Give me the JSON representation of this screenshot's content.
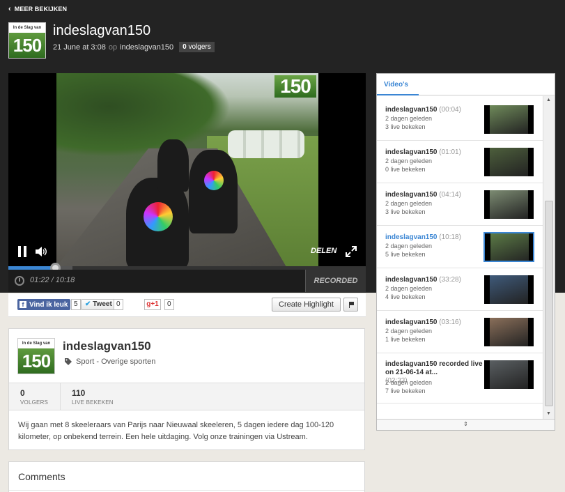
{
  "nav": {
    "back_label": "MEER BEKIJKEN"
  },
  "header": {
    "logo_text_top": "In de Slag van",
    "logo_text_number": "150",
    "title": "indeslagvan150",
    "date": "21 June at 3:08",
    "op_label": "op",
    "channel": "indeslagvan150",
    "followers_count": "0",
    "followers_label": "volgers"
  },
  "player": {
    "watermark": "150",
    "share_label": "DELEN",
    "time": "01:22 / 10:18",
    "progress_fraction": 0.13,
    "buffered_fraction": 0.18,
    "recorded_label": "RECORDED LIVE"
  },
  "social": {
    "facebook_label": "Vind ik leuk",
    "facebook_count": "5",
    "tweet_label": "Tweet",
    "tweet_count": "0",
    "gplus_label": "g+1",
    "gplus_count": "0",
    "highlight_label": "Create Highlight"
  },
  "channel_info": {
    "name": "indeslagvan150",
    "category": "Sport - Overige sporten",
    "followers_value": "0",
    "followers_label": "VOLGERS",
    "views_value": "110",
    "views_label": "LIVE BEKEKEN",
    "description": "Wij gaan met 8 skeeleraars van Parijs naar Nieuwaal skeeleren, 5 dagen iedere dag 100-120 kilometer, op onbekend terrein. Een hele uitdaging. Volg onze trainingen via Ustream."
  },
  "comments": {
    "title": "Comments"
  },
  "sidebar": {
    "tab_label": "Video's",
    "items": [
      {
        "title": "indeslagvan150",
        "duration": "(00:04)",
        "age": "2 dagen geleden",
        "views": "3 live bekeken",
        "active": false,
        "thumb_color": "#6f8a5a"
      },
      {
        "title": "indeslagvan150",
        "duration": "(01:01)",
        "age": "2 dagen geleden",
        "views": "0 live bekeken",
        "active": false,
        "thumb_color": "#4d5f3c"
      },
      {
        "title": "indeslagvan150",
        "duration": "(04:14)",
        "age": "2 dagen geleden",
        "views": "3 live bekeken",
        "active": false,
        "thumb_color": "#7c8b72"
      },
      {
        "title": "indeslagvan150",
        "duration": "(10:18)",
        "age": "2 dagen geleden",
        "views": "5 live bekeken",
        "active": true,
        "thumb_color": "#5b7a46"
      },
      {
        "title": "indeslagvan150",
        "duration": "(33:28)",
        "age": "2 dagen geleden",
        "views": "4 live bekeken",
        "active": false,
        "thumb_color": "#3f5a7a"
      },
      {
        "title": "indeslagvan150",
        "duration": "(03:16)",
        "age": "2 dagen geleden",
        "views": "1 live bekeken",
        "active": false,
        "thumb_color": "#8a6f5a"
      },
      {
        "title": "indeslagvan150 recorded live on 21-06-14 at...",
        "duration": "(02:33)",
        "age": "2 dagen geleden",
        "views": "7 live bekeken",
        "active": false,
        "thumb_color": "#5a5f62"
      }
    ]
  }
}
